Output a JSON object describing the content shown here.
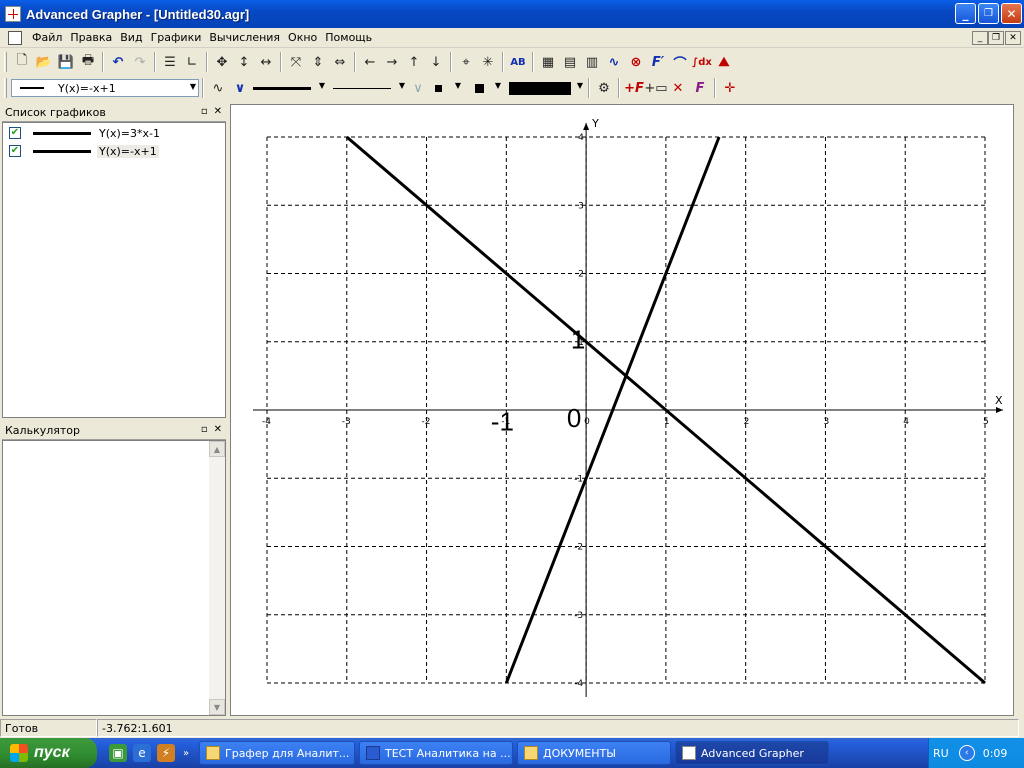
{
  "window": {
    "title": "Advanced Grapher - [Untitled30.agr]",
    "min_label": "_",
    "max_label": "❐",
    "close_label": "✕"
  },
  "menu": [
    "Файл",
    "Правка",
    "Вид",
    "Графики",
    "Вычисления",
    "Окно",
    "Помощь"
  ],
  "toolbar2": {
    "graph_combo_value": "Y(x)=-x+1"
  },
  "graph_list_panel": {
    "title": "Список графиков",
    "items": [
      {
        "label": "Y(x)=3*x-1",
        "checked": true
      },
      {
        "label": "Y(x)=-x+1",
        "checked": true
      }
    ]
  },
  "calculator_panel": {
    "title": "Калькулятор"
  },
  "status": {
    "state": "Готов",
    "coords": "-3.762:1.601"
  },
  "taskbar": {
    "start": "пуск",
    "tasks": [
      {
        "label": "Графер для Аналит...",
        "active": false
      },
      {
        "label": "ТЕСТ Аналитика на ...",
        "active": false
      },
      {
        "label": "ДОКУМЕНТЫ",
        "active": false
      },
      {
        "label": "Advanced Grapher",
        "active": true
      }
    ],
    "lang": "RU",
    "time": "0:09"
  },
  "chart_data": {
    "type": "line",
    "title": "",
    "xlabel": "X",
    "ylabel": "Y",
    "xlim": [
      -4,
      5
    ],
    "ylim": [
      -4,
      4
    ],
    "grid": true,
    "x_ticks": [
      "-4",
      "-3",
      "-2",
      "-1",
      "0",
      "1",
      "2",
      "3",
      "4",
      "5"
    ],
    "y_ticks": [
      "4",
      "3",
      "2",
      "1",
      "-1",
      "-2",
      "-3",
      "-4"
    ],
    "series": [
      {
        "name": "Y(x)=3*x-1",
        "x": [
          -1,
          1.6667
        ],
        "y": [
          -4,
          4
        ],
        "color": "#000000"
      },
      {
        "name": "Y(x)=-x+1",
        "x": [
          -3,
          5
        ],
        "y": [
          4,
          -4
        ],
        "color": "#000000"
      }
    ],
    "annotations": [
      {
        "text": "1",
        "x": -0.1,
        "y": 0.9
      },
      {
        "text": "-1",
        "x": -1.05,
        "y": -0.3
      },
      {
        "text": "0",
        "x": -0.15,
        "y": -0.25
      }
    ]
  }
}
